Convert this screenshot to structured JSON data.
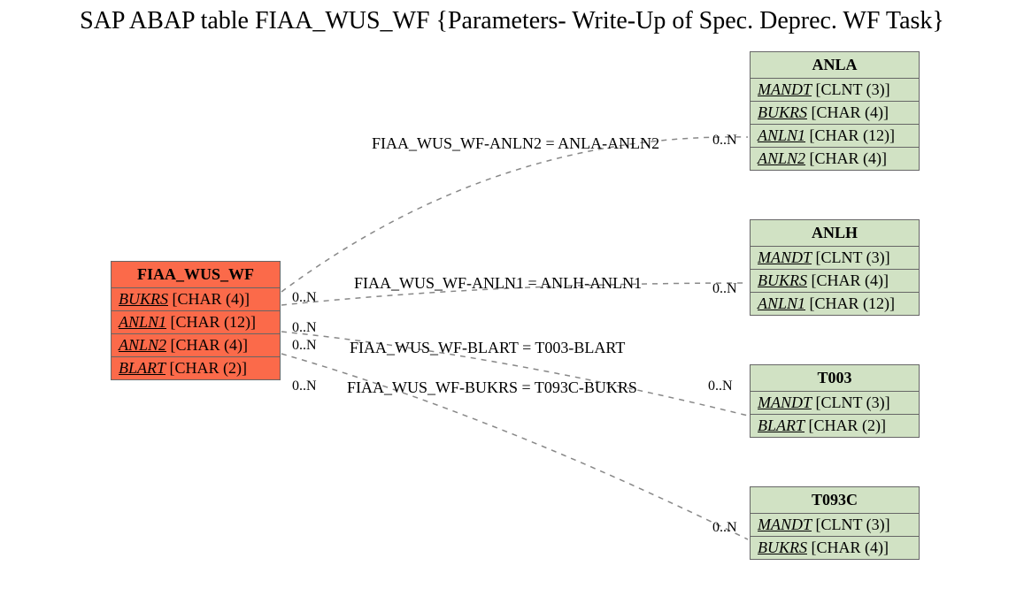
{
  "title": "SAP ABAP table FIAA_WUS_WF {Parameters- Write-Up of Spec. Deprec. WF Task}",
  "main": {
    "name": "FIAA_WUS_WF",
    "fields": [
      {
        "name": "BUKRS",
        "type": "[CHAR (4)]"
      },
      {
        "name": "ANLN1",
        "type": "[CHAR (12)]"
      },
      {
        "name": "ANLN2",
        "type": "[CHAR (4)]"
      },
      {
        "name": "BLART",
        "type": "[CHAR (2)]"
      }
    ]
  },
  "ref": {
    "anla": {
      "name": "ANLA",
      "fields": [
        {
          "name": "MANDT",
          "type": "[CLNT (3)]"
        },
        {
          "name": "BUKRS",
          "type": "[CHAR (4)]"
        },
        {
          "name": "ANLN1",
          "type": "[CHAR (12)]"
        },
        {
          "name": "ANLN2",
          "type": "[CHAR (4)]"
        }
      ]
    },
    "anlh": {
      "name": "ANLH",
      "fields": [
        {
          "name": "MANDT",
          "type": "[CLNT (3)]"
        },
        {
          "name": "BUKRS",
          "type": "[CHAR (4)]"
        },
        {
          "name": "ANLN1",
          "type": "[CHAR (12)]"
        }
      ]
    },
    "t003": {
      "name": "T003",
      "fields": [
        {
          "name": "MANDT",
          "type": "[CLNT (3)]"
        },
        {
          "name": "BLART",
          "type": "[CHAR (2)]"
        }
      ]
    },
    "t093c": {
      "name": "T093C",
      "fields": [
        {
          "name": "MANDT",
          "type": "[CLNT (3)]"
        },
        {
          "name": "BUKRS",
          "type": "[CHAR (4)]"
        }
      ]
    }
  },
  "rel": {
    "r1": {
      "label": "FIAA_WUS_WF-ANLN2 = ANLA-ANLN2",
      "leftCard": "0..N",
      "rightCard": "0..N"
    },
    "r2": {
      "label": "FIAA_WUS_WF-ANLN1 = ANLH-ANLN1",
      "leftCard": "0..N",
      "rightCard": "0..N"
    },
    "r3": {
      "label": "FIAA_WUS_WF-BLART = T003-BLART",
      "leftCard": "0..N",
      "rightCard": "0..N"
    },
    "r4": {
      "label": "FIAA_WUS_WF-BUKRS = T093C-BUKRS",
      "leftCard": "0..N",
      "rightCard": "0..N"
    }
  }
}
